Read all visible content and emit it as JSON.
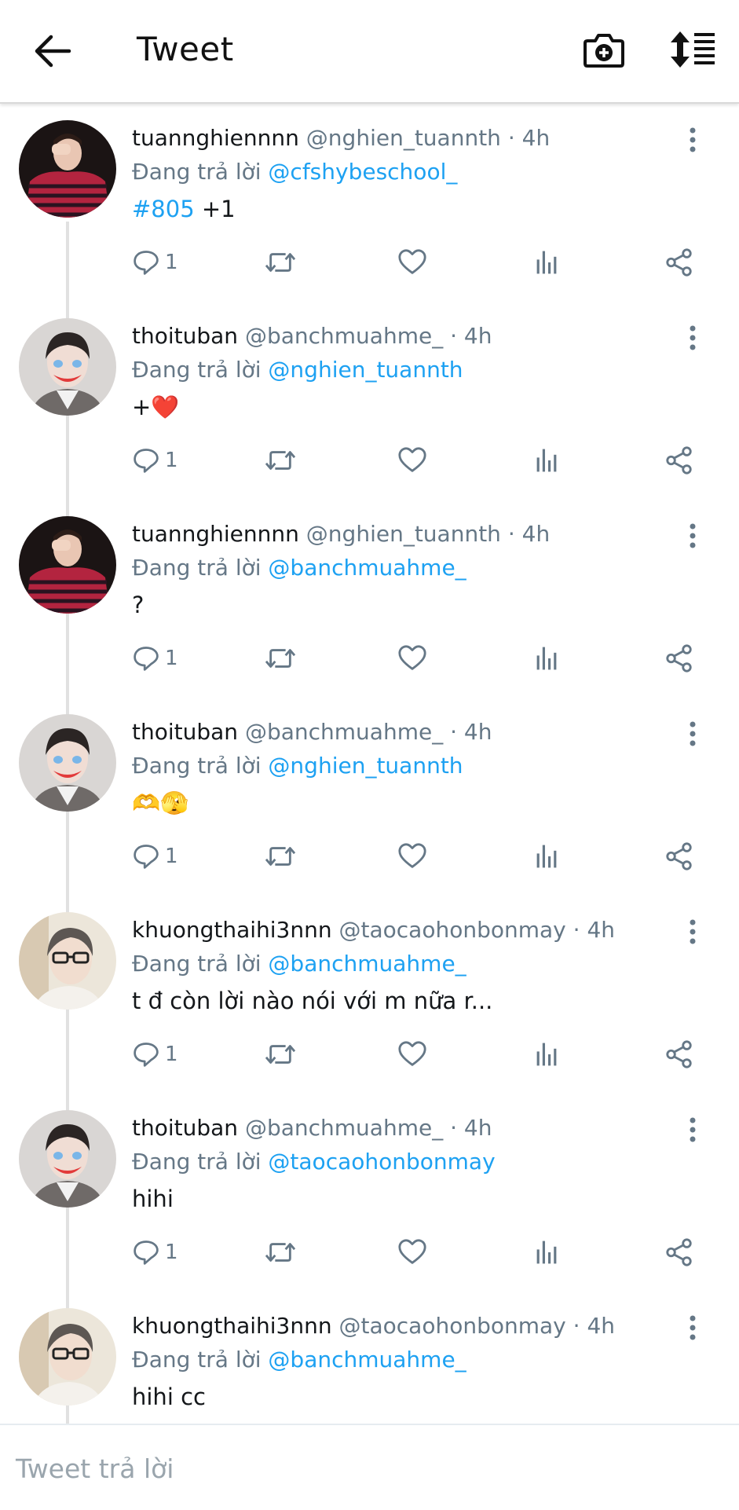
{
  "header": {
    "title": "Tweet",
    "back_icon": "arrow-left-icon",
    "camera_icon": "camera-plus-icon",
    "sort_icon": "sort-list-icon"
  },
  "colors": {
    "accent": "#1da1f2",
    "muted": "#657786",
    "text": "#14171a"
  },
  "tweets": [
    {
      "name": "tuannghiennnn",
      "handle": "@nghien_tuannth",
      "time": "· 4h",
      "reply_label": "Đang trả lời",
      "reply_to": "@cfshybeschool_",
      "hashtag": "#805",
      "text": " +1",
      "replies": "1"
    },
    {
      "name": "thoituban",
      "handle": "@banchmuahme_",
      "time": "· 4h",
      "reply_label": "Đang trả lời",
      "reply_to": "@nghien_tuannth",
      "text": "+❤️",
      "replies": "1"
    },
    {
      "name": "tuannghiennnn",
      "handle": "@nghien_tuannth",
      "time": "· 4h",
      "reply_label": "Đang trả lời",
      "reply_to": "@banchmuahme_",
      "text": "?",
      "replies": "1"
    },
    {
      "name": "thoituban",
      "handle": "@banchmuahme_",
      "time": "· 4h",
      "reply_label": "Đang trả lời",
      "reply_to": "@nghien_tuannth",
      "text": "🫶🫣",
      "replies": "1"
    },
    {
      "name": "khuongthaihi3nnn",
      "handle": "@taocaohonbonmay",
      "time": "· 4h",
      "reply_label": "Đang trả lời",
      "reply_to": "@banchmuahme_",
      "text": "t đ còn lời nào nói với m nữa r...",
      "replies": "1"
    },
    {
      "name": "thoituban",
      "handle": "@banchmuahme_",
      "time": "· 4h",
      "reply_label": "Đang trả lời",
      "reply_to": "@taocaohonbonmay",
      "text": "hihi",
      "replies": "1"
    },
    {
      "name": "khuongthaihi3nnn",
      "handle": "@taocaohonbonmay",
      "time": "· 4h",
      "reply_label": "Đang trả lời",
      "reply_to": "@banchmuahme_",
      "text": "hihi cc"
    }
  ],
  "reply_box": {
    "placeholder": "Tweet trả lời"
  }
}
